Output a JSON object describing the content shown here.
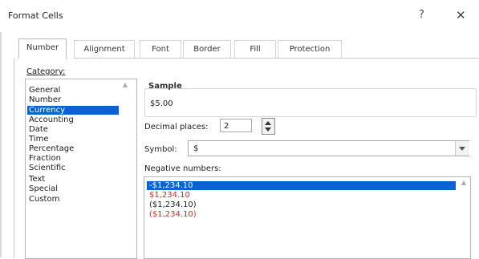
{
  "window": {
    "title": "Format Cells",
    "help_label": "?",
    "close_label": "✕"
  },
  "tabs": [
    {
      "label": "Number",
      "active": true
    },
    {
      "label": "Alignment"
    },
    {
      "label": "Font"
    },
    {
      "label": "Border"
    },
    {
      "label": "Fill"
    },
    {
      "label": "Protection"
    }
  ],
  "category": {
    "label": "Category:",
    "items": [
      "General",
      "Number",
      "Currency",
      "Accounting",
      "Date",
      "Time",
      "Percentage",
      "Fraction",
      "Scientific",
      "Text",
      "Special",
      "Custom"
    ],
    "selected": "Currency"
  },
  "sample": {
    "label": "Sample",
    "value": "$5.00"
  },
  "decimal_places": {
    "label": "Decimal places:",
    "value": "2"
  },
  "symbol": {
    "label": "Symbol:",
    "value": "$"
  },
  "negative_numbers": {
    "label": "Negative numbers:",
    "items": [
      {
        "text": "-$1,234.10",
        "color": "#ffffff",
        "selected": true
      },
      {
        "text": "$1,234.10",
        "color": "#e12525"
      },
      {
        "text": "($1,234.10)",
        "color": "#222222"
      },
      {
        "text": "($1,234.10)",
        "color": "#e12525"
      }
    ]
  },
  "colors": {
    "accent": "#0b63d1",
    "negative_red": "#e12525"
  }
}
